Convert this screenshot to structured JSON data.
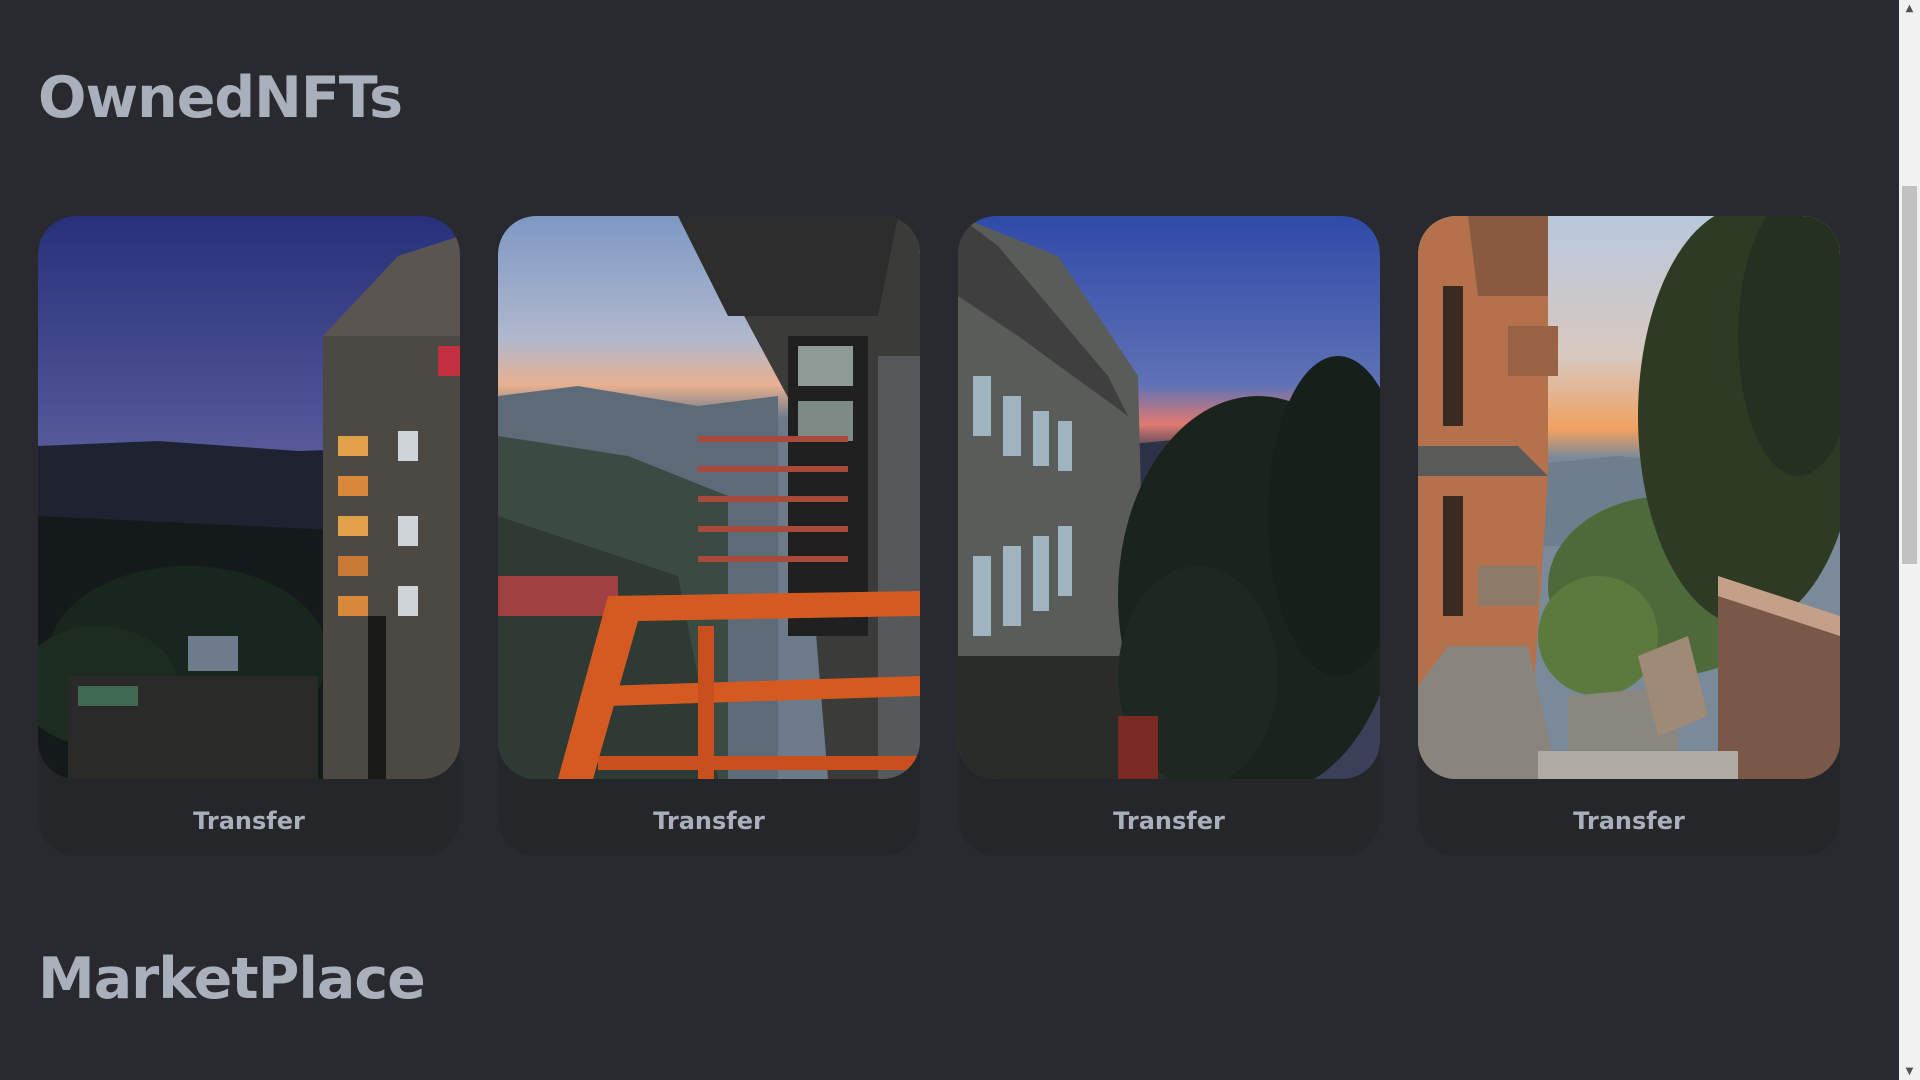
{
  "sections": {
    "owned_title": "OwnedNFTs",
    "market_title": "MarketPlace"
  },
  "cards": [
    {
      "button_label": "Transfer",
      "image": "dusk-building-valley-lights"
    },
    {
      "button_label": "Transfer",
      "image": "orange-railing-mountains"
    },
    {
      "button_label": "Transfer",
      "image": "building-facade-trees-dusk"
    },
    {
      "button_label": "Transfer",
      "image": "sunset-trees-stone-steps"
    }
  ],
  "scrollbar": {
    "up_icon": "triangle-up",
    "down_icon": "triangle-down"
  },
  "colors": {
    "background": "#282a2f",
    "heading": "#aab0bb",
    "card": "#252629"
  }
}
